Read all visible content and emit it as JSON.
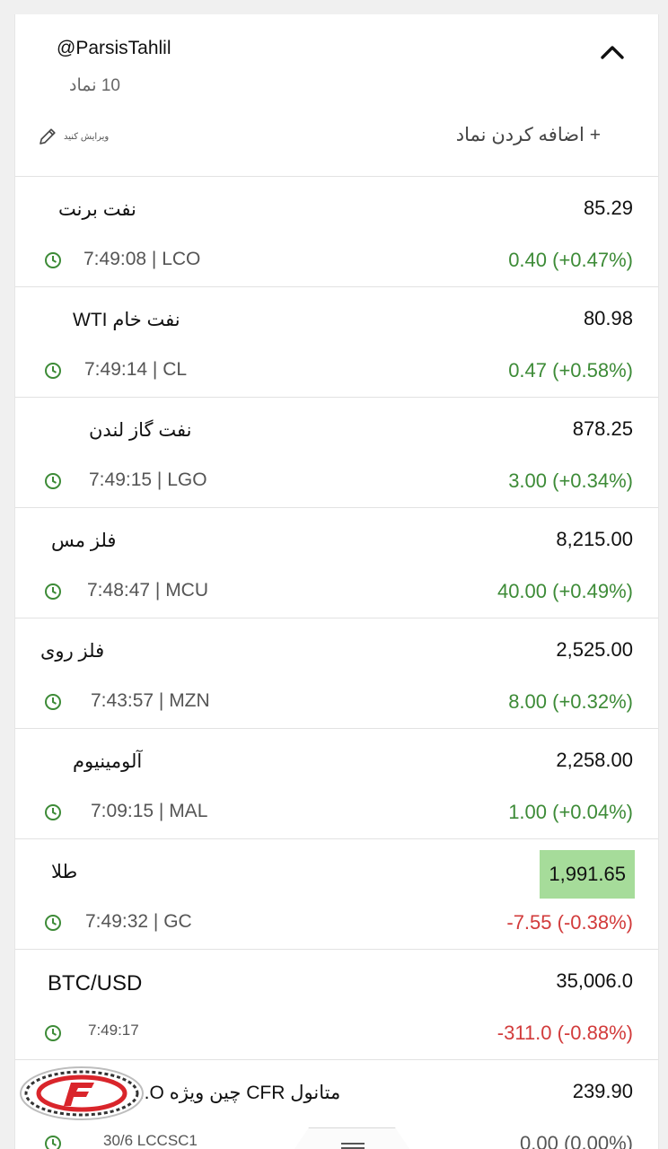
{
  "header": {
    "title": "@ParsisTahlil",
    "count": "10 نماد",
    "edit_label": "ویرایش کنید",
    "add_label": "+ اضافه کردن نماد"
  },
  "colors": {
    "up": "#3d8b37",
    "down": "#d23b3b",
    "highlight": "#a6dc9a"
  },
  "rows": [
    {
      "name": "نفت برنت",
      "price": "85.29",
      "time": "7:49:08 | LCO",
      "change": "0.40 (+0.47%)",
      "direction": "up"
    },
    {
      "name": "نفت خام WTI",
      "price": "80.98",
      "time": "7:49:14 | CL",
      "change": "0.47 (+0.58%)",
      "direction": "up"
    },
    {
      "name": "نفت گاز لندن",
      "price": "878.25",
      "time": "7:49:15 | LGO",
      "change": "3.00 (+0.34%)",
      "direction": "up"
    },
    {
      "name": "فلز مس",
      "price": "8,215.00",
      "time": "7:48:47 | MCU",
      "change": "40.00 (+0.49%)",
      "direction": "up"
    },
    {
      "name": "فلز روی",
      "price": "2,525.00",
      "time": "7:43:57 | MZN",
      "change": "8.00 (+0.32%)",
      "direction": "up"
    },
    {
      "name": "آلومینیوم",
      "price": "2,258.00",
      "time": "7:09:15 | MAL",
      "change": "1.00 (+0.04%)",
      "direction": "up"
    },
    {
      "name": "طلا",
      "price": "1,991.65",
      "time": "7:49:32 | GC",
      "change": "-7.55 (-0.38%)",
      "direction": "down",
      "price_highlight": true
    },
    {
      "name": "BTC/USD",
      "price": "35,006.0",
      "time": "7:49:17",
      "change": "-311.0 (-0.88%)",
      "direction": "down"
    },
    {
      "name": "متانول CFR چین ویژه O...",
      "price": "239.90",
      "time": "30/6 LCCSC1",
      "change": "0.00 (0.00%)",
      "direction": "neutral"
    }
  ]
}
